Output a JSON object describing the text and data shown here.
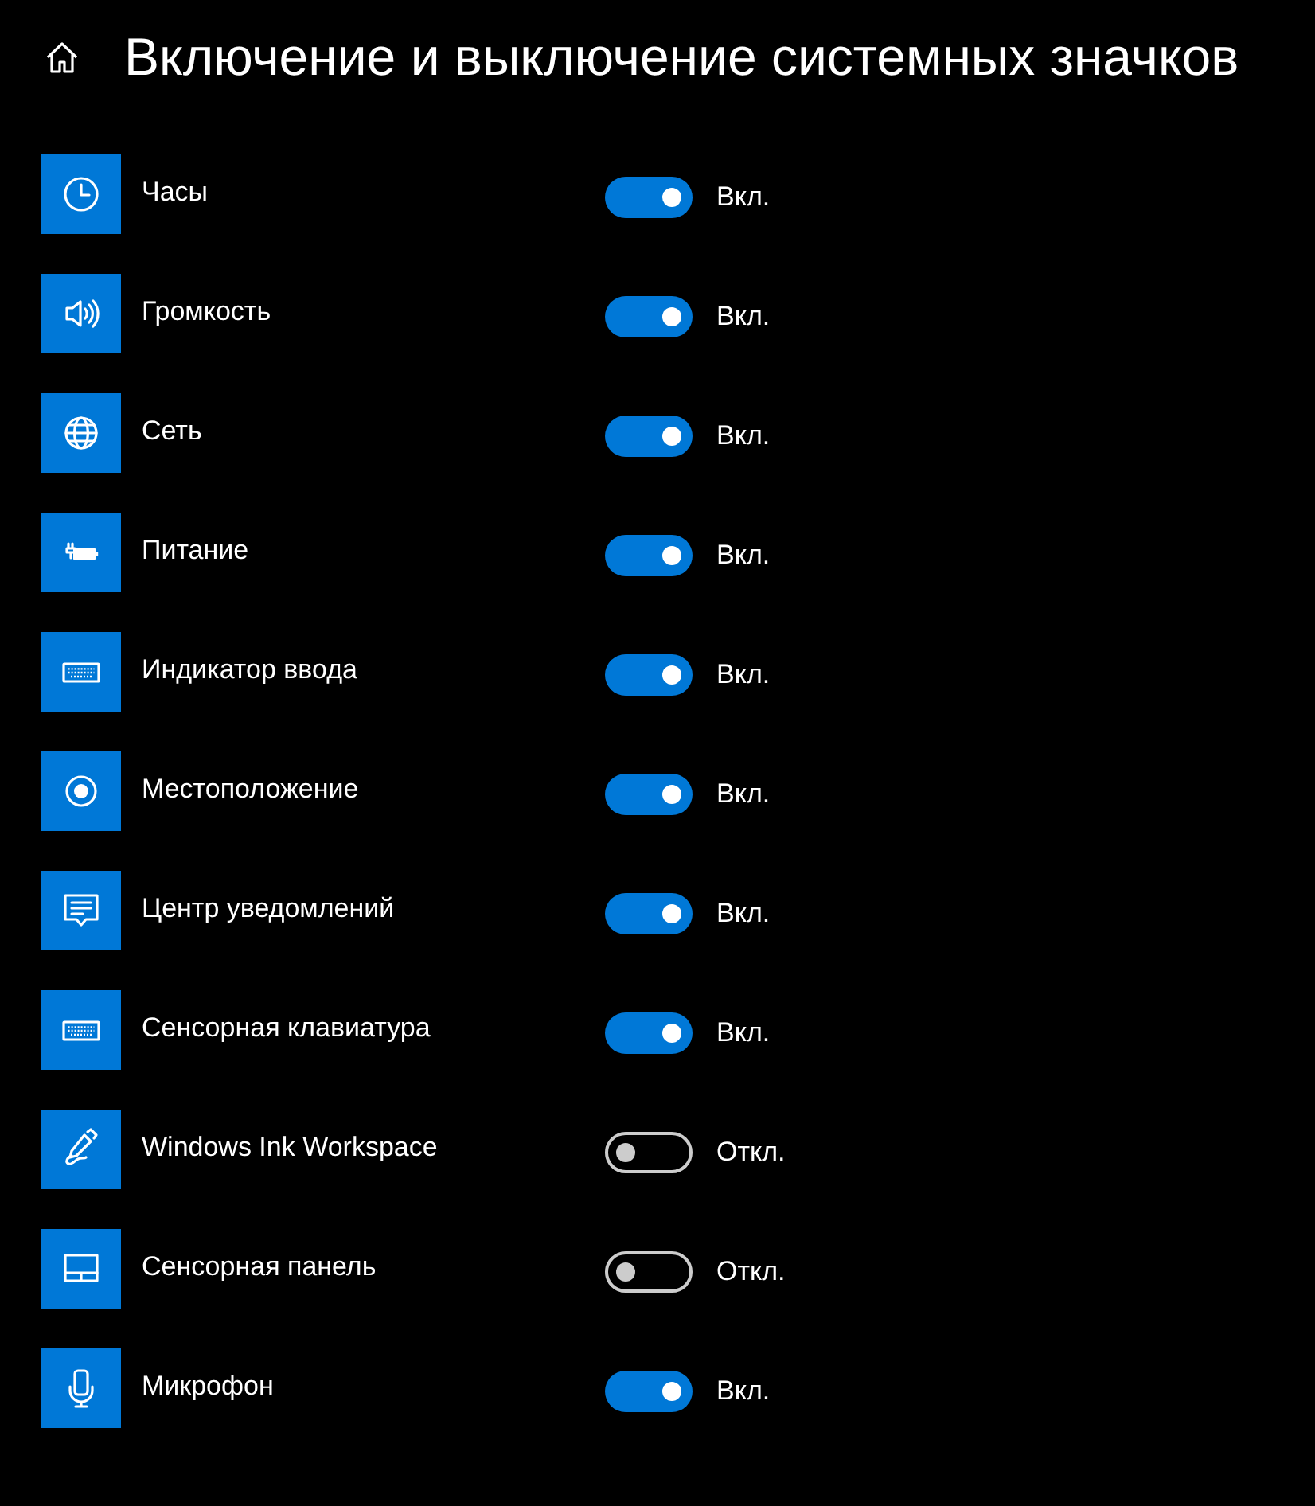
{
  "header": {
    "title": "Включение и выключение системных значков"
  },
  "items": [
    {
      "label": "Часы",
      "on": true,
      "status": "Вкл."
    },
    {
      "label": "Громкость",
      "on": true,
      "status": "Вкл."
    },
    {
      "label": "Сеть",
      "on": true,
      "status": "Вкл."
    },
    {
      "label": "Питание",
      "on": true,
      "status": "Вкл."
    },
    {
      "label": "Индикатор ввода",
      "on": true,
      "status": "Вкл."
    },
    {
      "label": "Местоположение",
      "on": true,
      "status": "Вкл."
    },
    {
      "label": "Центр уведомлений",
      "on": true,
      "status": "Вкл."
    },
    {
      "label": "Сенсорная клавиатура",
      "on": true,
      "status": "Вкл."
    },
    {
      "label": "Windows Ink Workspace",
      "on": false,
      "status": "Откл."
    },
    {
      "label": "Сенсорная панель",
      "on": false,
      "status": "Откл."
    },
    {
      "label": "Микрофон",
      "on": true,
      "status": "Вкл."
    }
  ]
}
